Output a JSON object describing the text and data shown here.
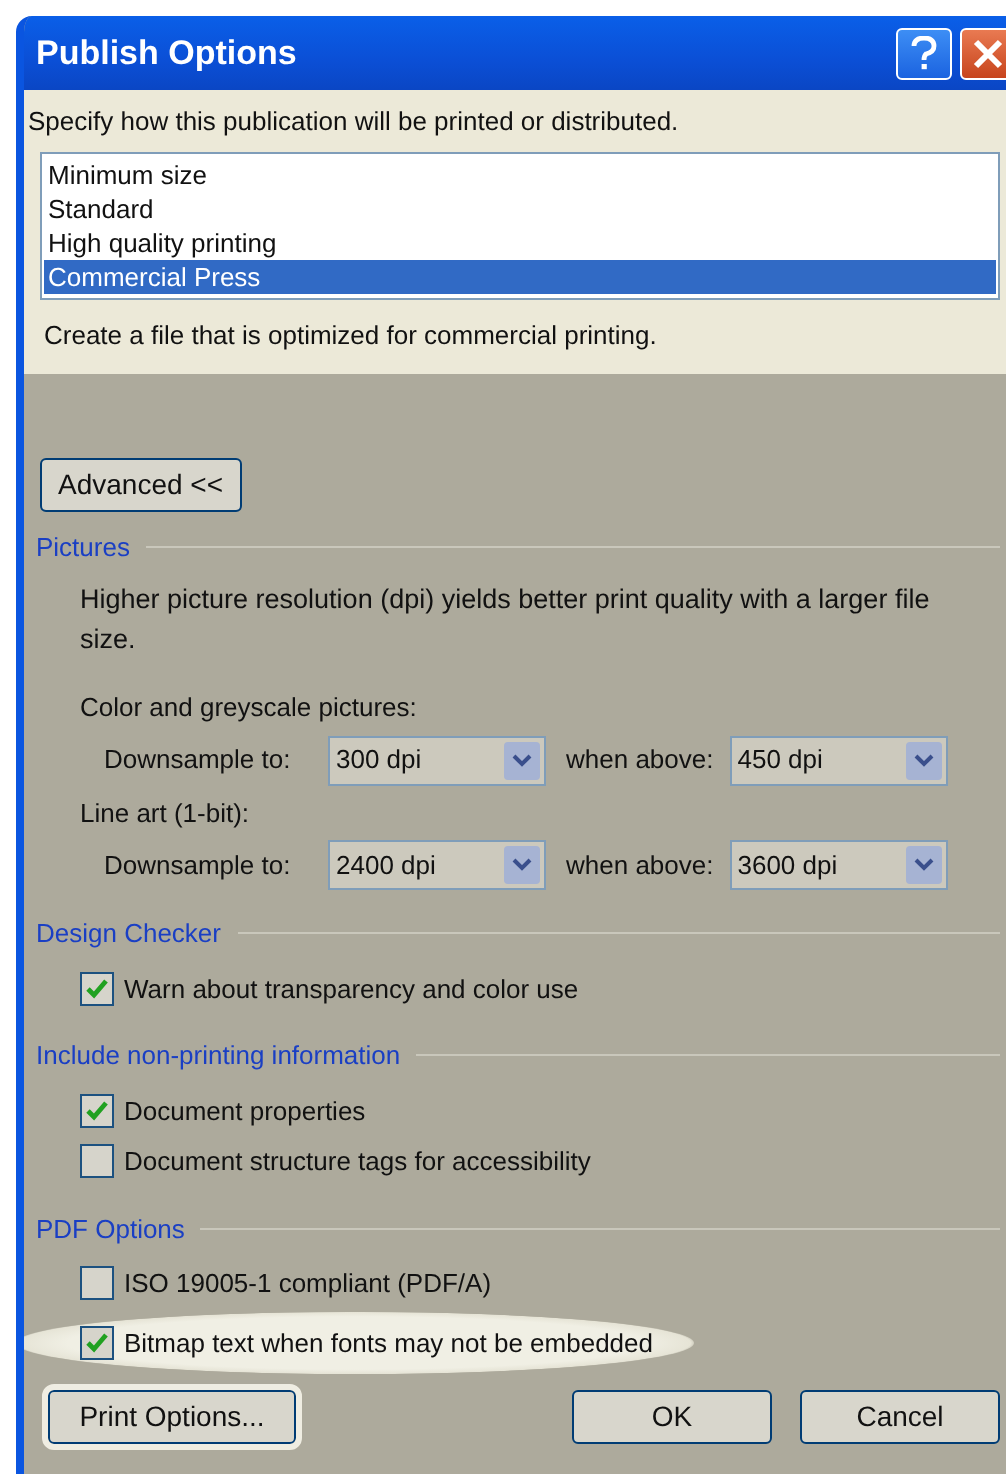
{
  "window": {
    "title": "Publish Options"
  },
  "prompt": "Specify how this publication will be printed or distributed.",
  "presets": [
    {
      "label": "Minimum size",
      "selected": false
    },
    {
      "label": "Standard",
      "selected": false
    },
    {
      "label": "High quality printing",
      "selected": false
    },
    {
      "label": "Commercial Press",
      "selected": true
    }
  ],
  "description": "Create a file that is optimized for commercial printing.",
  "advanced_button": "Advanced <<",
  "sections": [
    {
      "title": "Pictures",
      "items": [
        {
          "kind": "text",
          "text": "Higher picture resolution (dpi) yields better print quality with a larger file size."
        },
        {
          "kind": "subheading",
          "text": "Color and greyscale pictures:"
        },
        {
          "kind": "dropdowns",
          "label": "Downsample to:",
          "value": "300 dpi",
          "label2": "when above:",
          "value2": "450 dpi"
        },
        {
          "kind": "subheading",
          "text": "Line art (1-bit):"
        },
        {
          "kind": "dropdowns",
          "label": "Downsample to:",
          "value": "2400 dpi",
          "label2": "when above:",
          "value2": "3600 dpi"
        }
      ]
    },
    {
      "title": "Design Checker",
      "items": [
        {
          "kind": "checkbox",
          "text": "Warn about transparency and color use",
          "checked": true,
          "highlighted": false
        }
      ]
    },
    {
      "title": "Include non-printing information",
      "items": [
        {
          "kind": "checkbox",
          "text": "Document properties",
          "checked": true,
          "highlighted": false
        },
        {
          "kind": "checkbox",
          "text": "Document structure tags for accessibility",
          "checked": false,
          "highlighted": false
        }
      ]
    },
    {
      "title": "PDF Options",
      "items": [
        {
          "kind": "checkbox",
          "text": "ISO 19005-1 compliant (PDF/A)",
          "checked": false,
          "highlighted": false
        },
        {
          "kind": "checkbox",
          "text": "Bitmap text when fonts may not be embedded",
          "checked": true,
          "highlighted": true
        }
      ]
    }
  ],
  "footer_buttons": [
    {
      "label": "Print Options...",
      "highlighted": true,
      "kind": "left"
    },
    {
      "label": "OK",
      "highlighted": false,
      "kind": "right"
    },
    {
      "label": "Cancel",
      "highlighted": false,
      "kind": "right"
    }
  ]
}
